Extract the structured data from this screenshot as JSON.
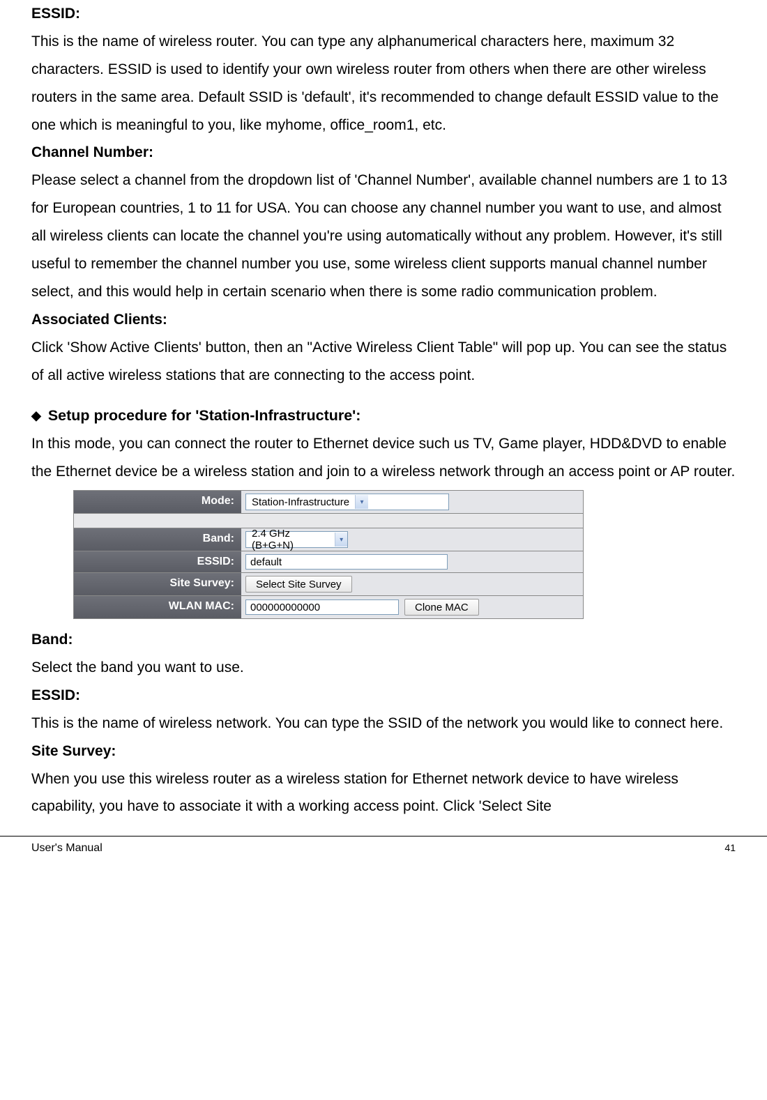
{
  "sections": {
    "essid": {
      "label": "ESSID:",
      "text": "This is the name of wireless router. You can type any alphanumerical characters here, maximum 32 characters. ESSID is used to identify your own wireless router from others when there are other wireless routers in the same area. Default SSID is 'default', it's recommended to change default ESSID value to the one which is meaningful to you, like myhome, office_room1, etc."
    },
    "channel": {
      "label": "Channel Number:",
      "text": "Please select a channel from the dropdown list of 'Channel Number', available channel numbers are 1 to 13 for European countries, 1 to 11 for USA. You can choose any channel number you want to use, and almost all wireless clients can locate the channel you're using automatically without any problem. However, it's still useful to remember the channel number you use, some wireless client supports manual channel number select, and this would help in certain scenario when there is some radio communication problem."
    },
    "assoc": {
      "label": "Associated Clients:",
      "text": "Click 'Show Active Clients' button, then an \"Active Wireless Client Table\" will pop up. You can see the status of all active wireless stations that are connecting to the access point."
    },
    "station_heading": "Setup procedure for 'Station-Infrastructure':",
    "station_intro": "In this mode, you can connect the router to Ethernet device such us TV, Game player, HDD&DVD to enable the Ethernet device be a wireless station and join to a wireless network through an access point or AP router.",
    "band": {
      "label": "Band:",
      "text": "Select the band you want to use."
    },
    "essid2": {
      "label": "ESSID:",
      "text": "This is the name of wireless network. You can type the SSID of the network you would like to connect here."
    },
    "sitesurvey": {
      "label": "Site Survey:",
      "text": "When you use this wireless router as a wireless station for Ethernet network device to have wireless capability, you have to associate it with a working access point. Click 'Select Site"
    }
  },
  "form": {
    "mode": {
      "label": "Mode:",
      "value": "Station-Infrastructure"
    },
    "band": {
      "label": "Band:",
      "value": "2.4 GHz (B+G+N)"
    },
    "essid": {
      "label": "ESSID:",
      "value": "default"
    },
    "survey": {
      "label": "Site Survey:",
      "button": "Select Site Survey"
    },
    "wlan": {
      "label": "WLAN MAC:",
      "value": "000000000000",
      "button": "Clone MAC"
    }
  },
  "footer": {
    "title": "User's Manual",
    "page": "41"
  }
}
